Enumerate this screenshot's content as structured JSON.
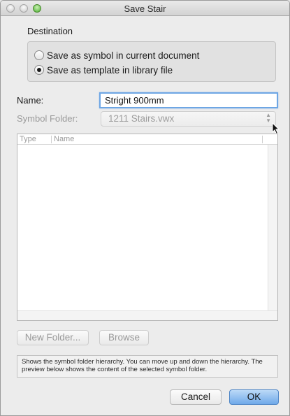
{
  "window": {
    "title": "Save Stair"
  },
  "destination": {
    "label": "Destination",
    "options": [
      {
        "label": "Save as symbol in current document",
        "checked": false
      },
      {
        "label": "Save as template in library file",
        "checked": true
      }
    ]
  },
  "name": {
    "label": "Name:",
    "value": "Stright 900mm"
  },
  "symbol_folder": {
    "label": "Symbol Folder:",
    "value": "1211 Stairs.vwx"
  },
  "list": {
    "columns": [
      "Type",
      "Name"
    ]
  },
  "buttons": {
    "new_folder": "New Folder...",
    "browse": "Browse",
    "cancel": "Cancel",
    "ok": "OK"
  },
  "help_text": "Shows the symbol folder hierarchy. You can move up and down the hierarchy. The preview below shows the content of the selected symbol folder.",
  "colors": {
    "accent": "#6ea6e4",
    "default_button": "#6fa9e9"
  }
}
